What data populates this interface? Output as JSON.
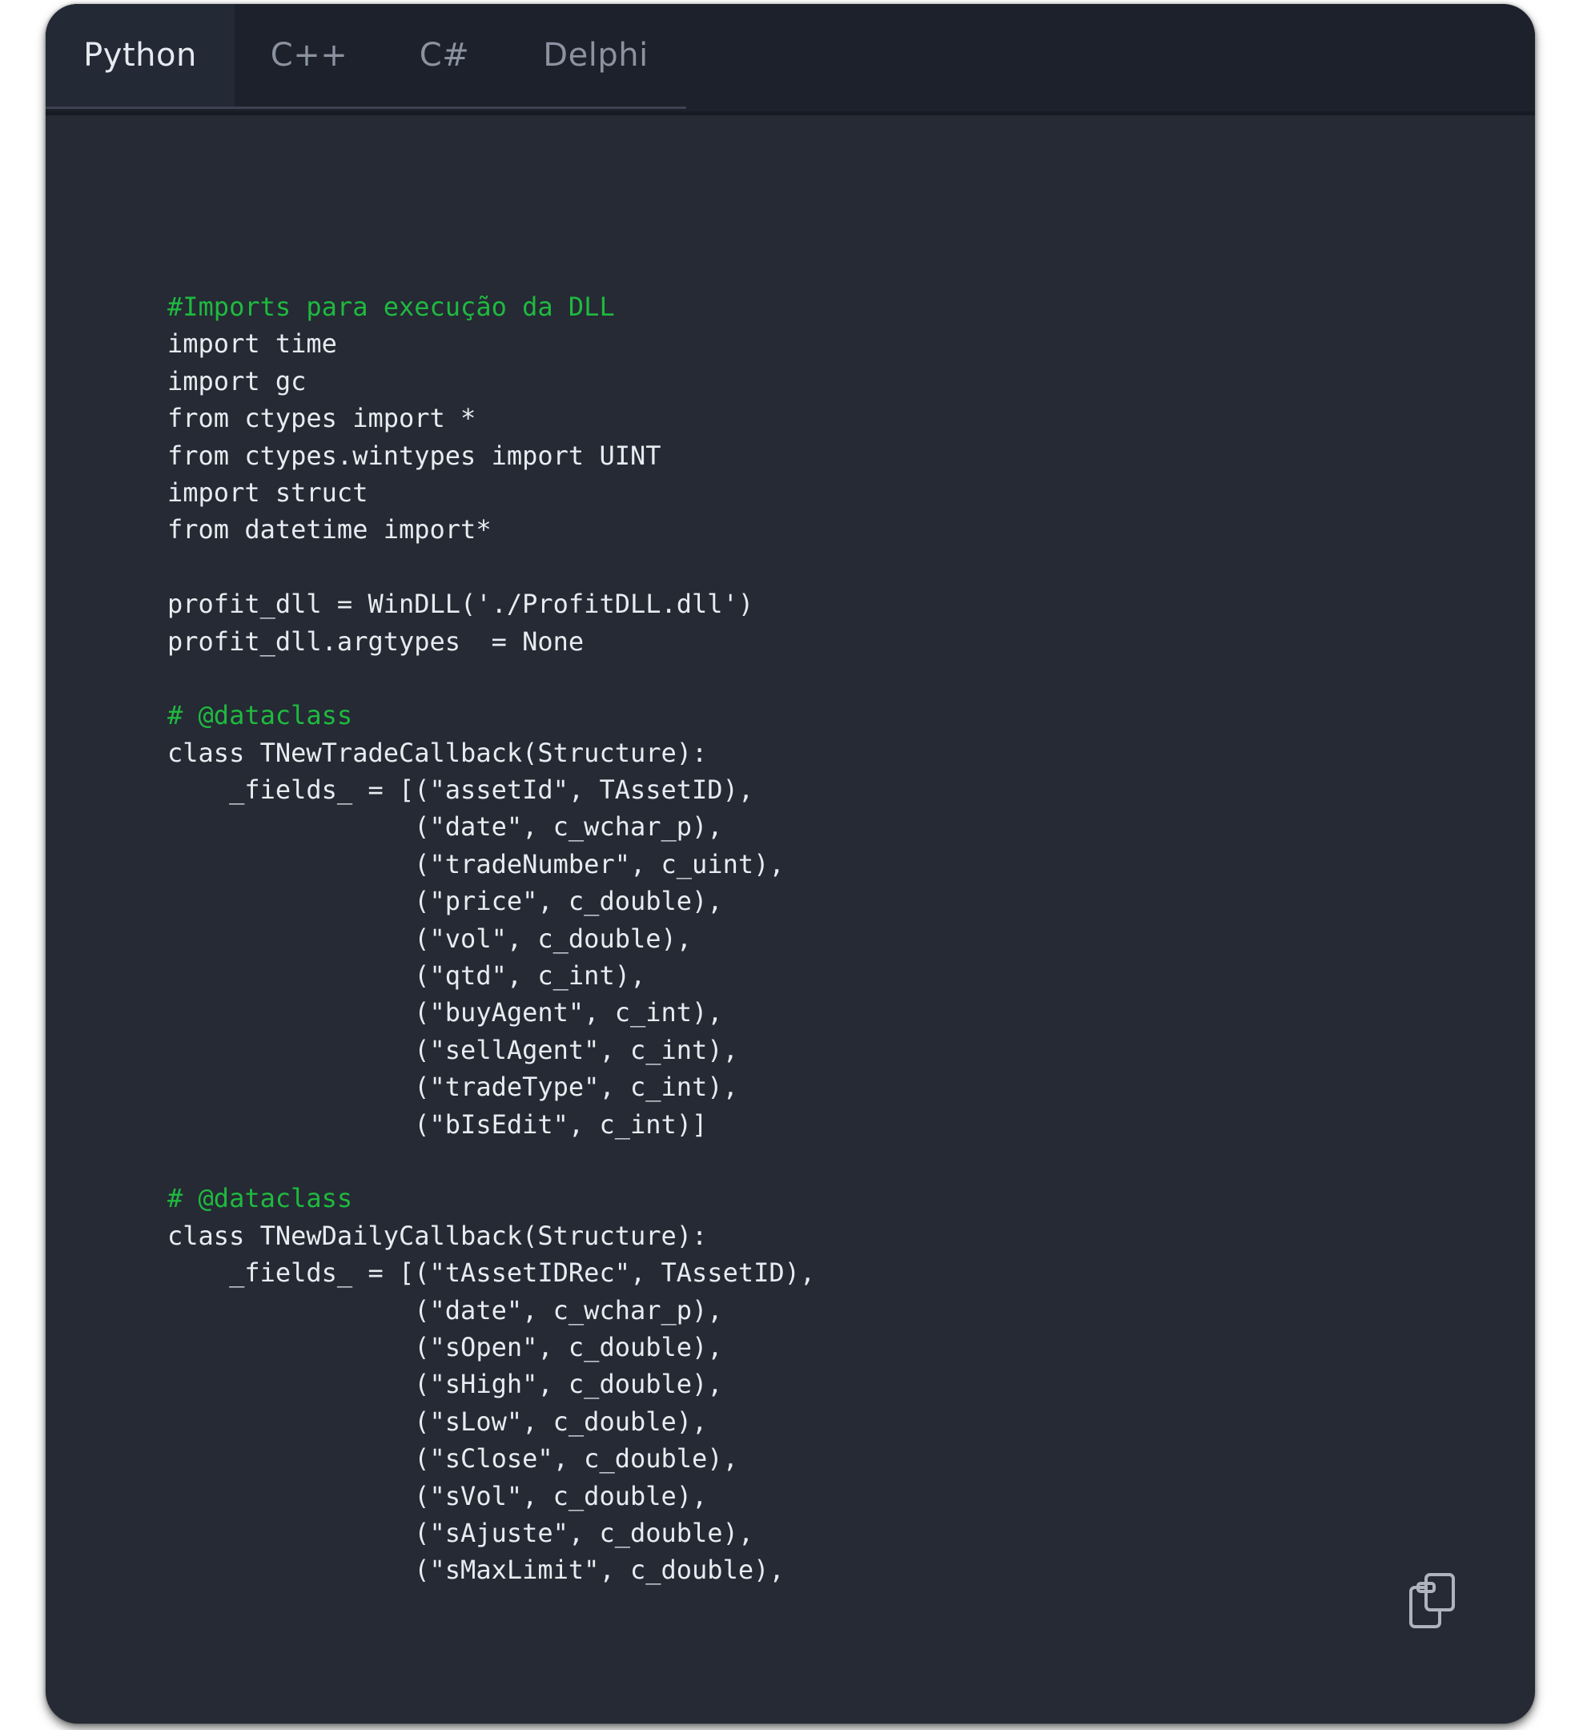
{
  "tabs": [
    {
      "label": "Python"
    },
    {
      "label": "C++"
    },
    {
      "label": "C#"
    },
    {
      "label": "Delphi"
    }
  ],
  "active_tab": "Python",
  "code_lines": [
    "#Imports para execução da DLL",
    "import time",
    "import gc",
    "from ctypes import *",
    "from ctypes.wintypes import UINT",
    "import struct",
    "from datetime import*",
    "",
    "profit_dll = WinDLL('./ProfitDLL.dll')",
    "profit_dll.argtypes  = None",
    "",
    "# @dataclass",
    "class TNewTradeCallback(Structure):",
    "    _fields_ = [(\"assetId\", TAssetID),",
    "                (\"date\", c_wchar_p),",
    "                (\"tradeNumber\", c_uint),",
    "                (\"price\", c_double),",
    "                (\"vol\", c_double),",
    "                (\"qtd\", c_int),",
    "                (\"buyAgent\", c_int),",
    "                (\"sellAgent\", c_int),",
    "                (\"tradeType\", c_int),",
    "                (\"bIsEdit\", c_int)]",
    "",
    "# @dataclass",
    "class TNewDailyCallback(Structure):",
    "    _fields_ = [(\"tAssetIDRec\", TAssetID),",
    "                (\"date\", c_wchar_p),",
    "                (\"sOpen\", c_double),",
    "                (\"sHigh\", c_double),",
    "                (\"sLow\", c_double),",
    "                (\"sClose\", c_double),",
    "                (\"sVol\", c_double),",
    "                (\"sAjuste\", c_double),",
    "                (\"sMaxLimit\", c_double),"
  ],
  "comment_color": "#1fb93f",
  "code_color": "#e8ebf0",
  "background_color": "#252a34",
  "icons": {
    "copy": "clipboard-copy-icon"
  }
}
